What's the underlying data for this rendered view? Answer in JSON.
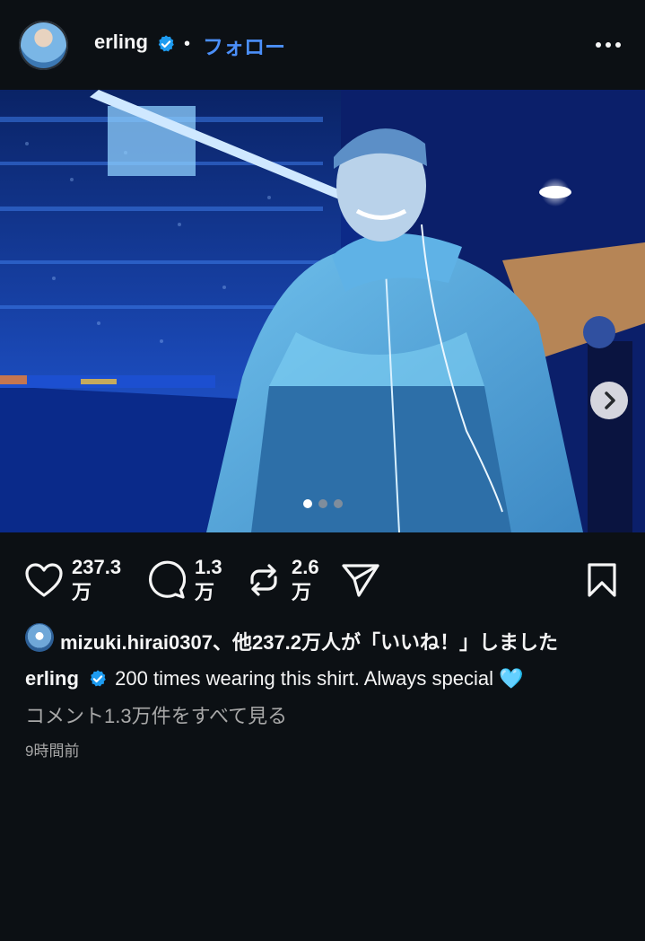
{
  "header": {
    "username": "erling",
    "separator": "•",
    "follow_label": "フォロー",
    "avatar_icon": "profile-avatar",
    "more_icon": "more-horizontal-icon"
  },
  "post": {
    "carousel": {
      "total": 3,
      "active_index": 0
    },
    "actions": {
      "likes": {
        "line1": "237.3",
        "line2": "万"
      },
      "comments": {
        "line1": "1.3",
        "line2": "万"
      },
      "reposts": {
        "line1": "2.6",
        "line2": "万"
      }
    },
    "liked_by": "mizuki.hirai0307、他237.2万人が「いいね！」しました",
    "caption": {
      "username": "erling",
      "text": "200 times wearing this shirt. Always special 🩵"
    },
    "view_comments": "コメント1.3万件をすべて見る",
    "timestamp": "9時間前"
  },
  "colors": {
    "background": "#0c1014",
    "link_blue": "#4b8ff9",
    "verified_blue": "#1d9bf0",
    "muted": "#a8a8a8"
  }
}
